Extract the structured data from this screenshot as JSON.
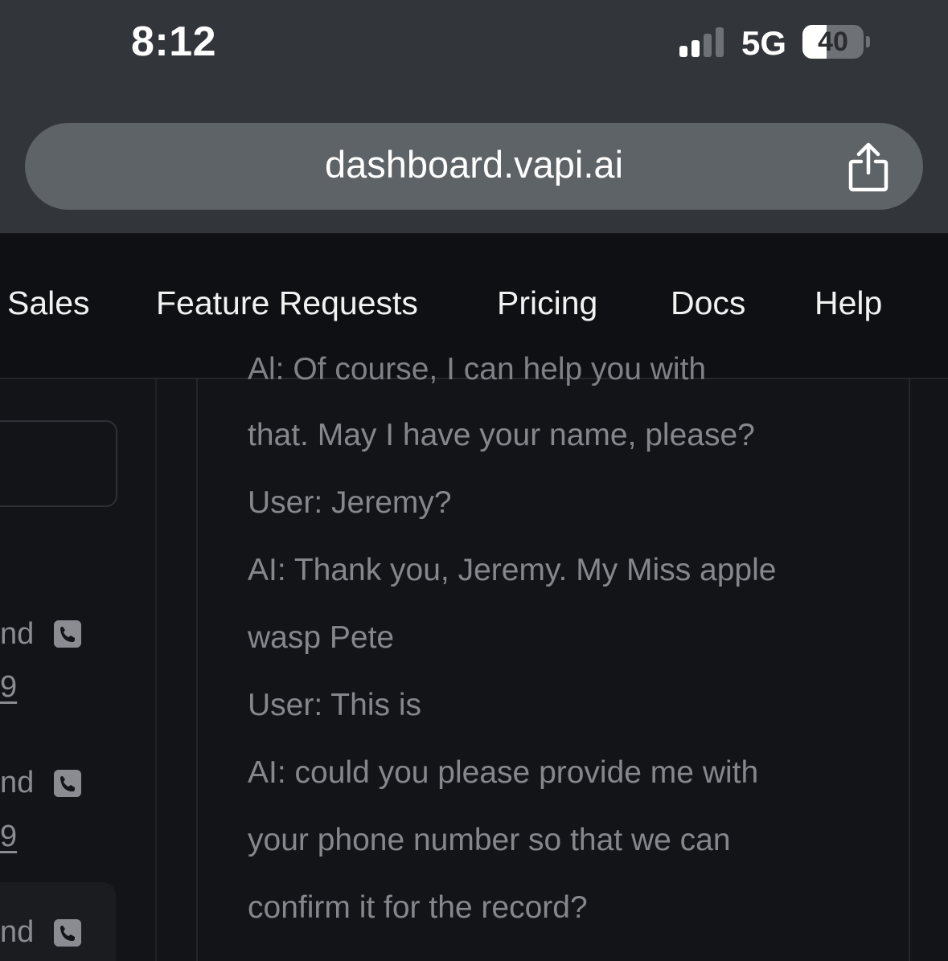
{
  "status_bar": {
    "time": "8:12",
    "network": "5G",
    "battery_level": "40",
    "battery_fraction": 0.4,
    "signal_bars_active": 2,
    "signal_bars_total": 4
  },
  "browser": {
    "url": "dashboard.vapi.ai",
    "share_icon": "share-icon"
  },
  "nav": {
    "items": [
      "Sales",
      "Feature Requests",
      "Pricing",
      "Docs",
      "Help"
    ]
  },
  "sidebar": {
    "rows": [
      {
        "label": "nd",
        "digit": "9",
        "icon": "phone-icon"
      },
      {
        "label": "nd",
        "digit": "9",
        "icon": "phone-icon"
      },
      {
        "label": "nd",
        "icon": "phone-icon"
      }
    ]
  },
  "transcript": {
    "cutoff_line": "Al: Of course, I can help you with",
    "lines": [
      "that. May I have your name, please?",
      "User: Jeremy?",
      "AI: Thank you, Jeremy. My Miss apple",
      "wasp Pete",
      "User: This is",
      "AI: could you please provide me with",
      "your phone number so that we can",
      "confirm it for the record?"
    ]
  },
  "colors": {
    "chrome_bg": "#323539",
    "url_bar_bg": "#5e6367",
    "page_bg": "#131417",
    "nav_bg": "#0f1013",
    "transcript_text": "#85878c"
  }
}
